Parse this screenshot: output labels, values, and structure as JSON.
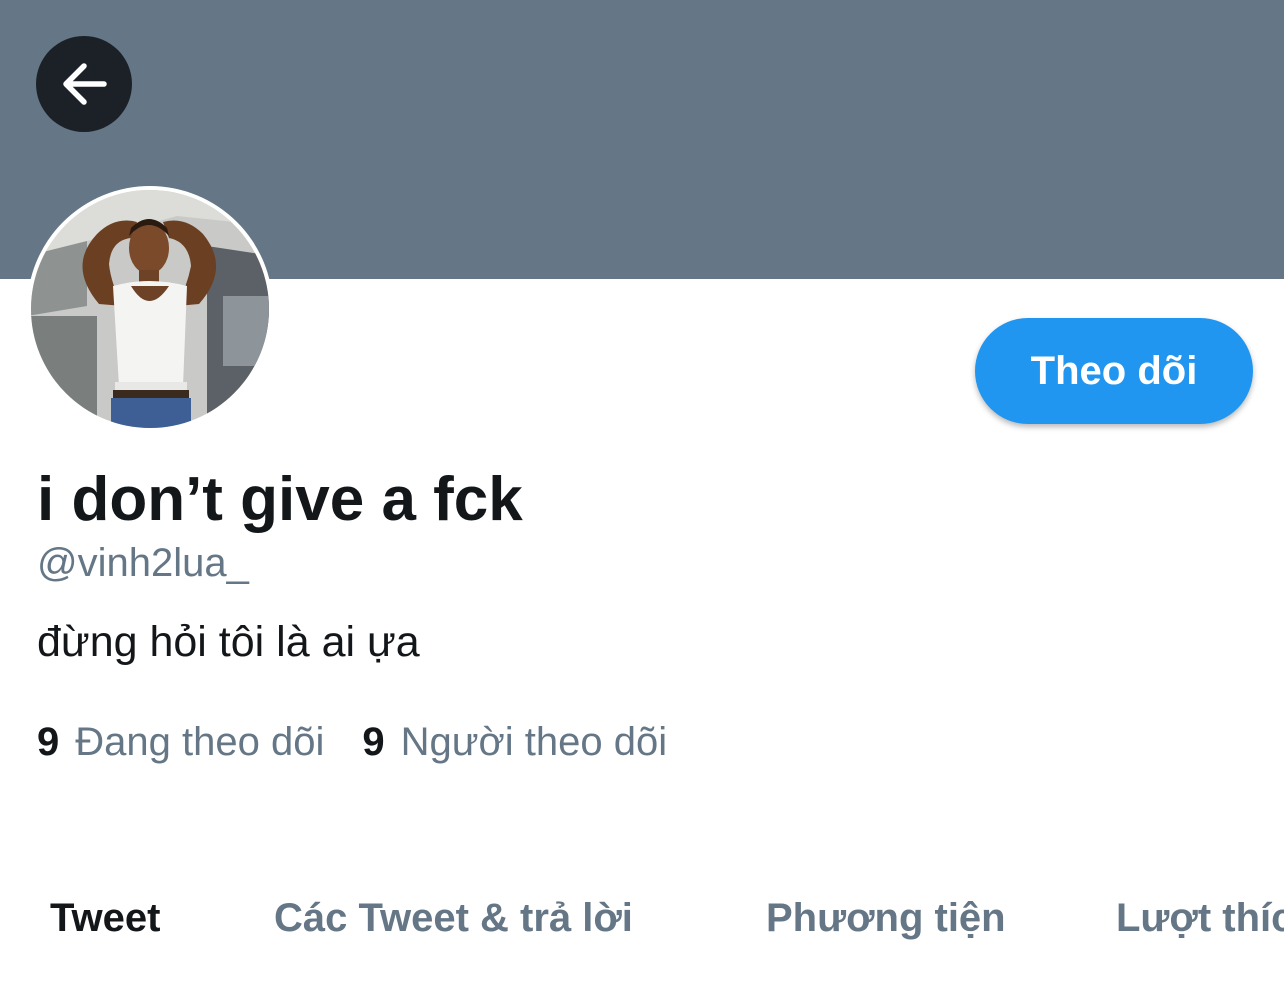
{
  "profile": {
    "display_name": "i don’t give a fck",
    "handle": "@vinh2lua_",
    "bio": "đừng hỏi tôi là ai ựa",
    "following_count": "9",
    "following_label": "Đang theo dõi",
    "followers_count": "9",
    "followers_label": "Người theo dõi"
  },
  "header": {
    "back_icon": "arrow-left-icon",
    "banner_color": "#657786"
  },
  "actions": {
    "follow_label": "Theo dõi",
    "follow_color": "#2196f0"
  },
  "tabs": [
    {
      "label": "Tweet",
      "active": true
    },
    {
      "label": "Các Tweet & trả lời",
      "active": false
    },
    {
      "label": "Phương tiện",
      "active": false
    },
    {
      "label": "Lượt thích",
      "active": false
    }
  ]
}
